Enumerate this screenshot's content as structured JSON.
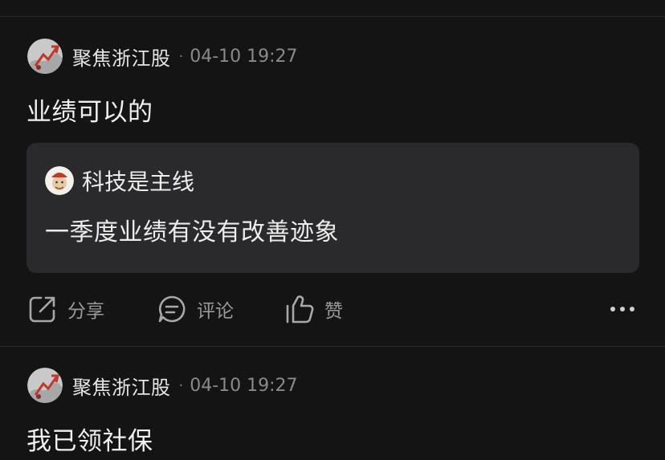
{
  "posts": [
    {
      "author": "聚焦浙江股",
      "separator": "·",
      "time": "04-10 19:27",
      "content": "业绩可以的",
      "quote": {
        "author": "科技是主线",
        "text": "一季度业绩有没有改善迹象"
      },
      "actions": {
        "share": "分享",
        "comment": "评论",
        "like": "赞",
        "more_icon": "more-dots-icon"
      }
    },
    {
      "author": "聚焦浙江股",
      "separator": "·",
      "time": "04-10 19:27",
      "content": "我已领社保"
    }
  ],
  "colors": {
    "background": "#141414",
    "card": "#2a2a2c",
    "text_primary": "#f0f0f0",
    "text_secondary": "#8a8a8a"
  }
}
